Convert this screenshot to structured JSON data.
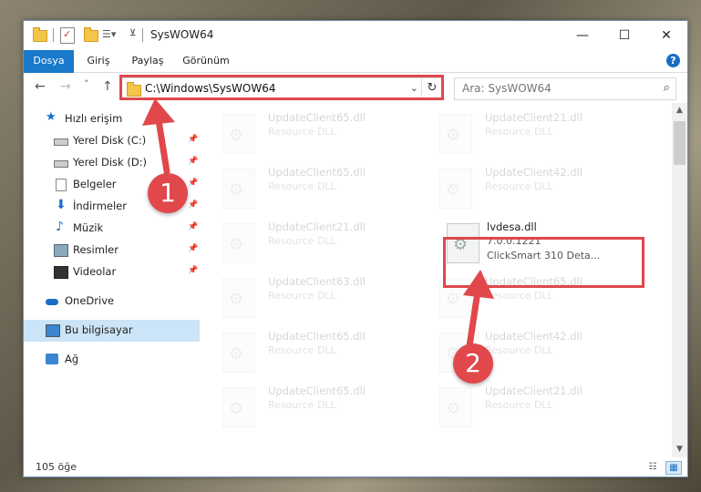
{
  "window": {
    "title": "SysWOW64"
  },
  "title_controls": {
    "minimize": "—",
    "maximize": "☐",
    "close": "✕"
  },
  "ribbon": {
    "tabs": [
      "Dosya",
      "Giriş",
      "Paylaş",
      "Görünüm"
    ],
    "help": "?"
  },
  "nav": {
    "back": "←",
    "forward": "→",
    "recent": "˅",
    "up": "↑",
    "address": "C:\\Windows\\SysWOW64",
    "address_chevron": "⌄",
    "refresh": "↻",
    "search_placeholder": "Ara: SysWOW64",
    "search_icon": "⌕"
  },
  "sidebar": {
    "items": [
      {
        "label": "Hızlı erişim",
        "icon": "star-icon",
        "pinned": false
      },
      {
        "label": "Yerel Disk (C:)",
        "icon": "drive-icon",
        "pinned": true
      },
      {
        "label": "Yerel Disk (D:)",
        "icon": "drive-icon",
        "pinned": true
      },
      {
        "label": "Belgeler",
        "icon": "documents-icon",
        "pinned": true
      },
      {
        "label": "İndirmeler",
        "icon": "downloads-icon",
        "pinned": true
      },
      {
        "label": "Müzik",
        "icon": "music-icon",
        "pinned": true
      },
      {
        "label": "Resimler",
        "icon": "pictures-icon",
        "pinned": true
      },
      {
        "label": "Videolar",
        "icon": "videos-icon",
        "pinned": true
      },
      {
        "label": "OneDrive",
        "icon": "cloud-icon",
        "pinned": false
      },
      {
        "label": "Bu bilgisayar",
        "icon": "computer-icon",
        "pinned": false,
        "selected": true
      },
      {
        "label": "Ağ",
        "icon": "network-icon",
        "pinned": false
      }
    ],
    "pin_glyph": "📌"
  },
  "files": {
    "left": [
      {
        "name": "UpdateClient65.dll",
        "desc": "Resource DLL"
      },
      {
        "name": "UpdateClient65.dll",
        "desc": "Resource DLL"
      },
      {
        "name": "UpdateClient21.dll",
        "desc": "Resource DLL"
      },
      {
        "name": "UpdateClient63.dll",
        "desc": "Resource DLL"
      },
      {
        "name": "UpdateClient65.dll",
        "desc": "Resource DLL"
      },
      {
        "name": "UpdateClient65.dll",
        "desc": "Resource DLL"
      }
    ],
    "right": [
      {
        "name": "UpdateClient21.dll",
        "desc": "Resource DLL"
      },
      {
        "name": "UpdateClient42.dll",
        "desc": "Resource DLL"
      },
      {
        "name": "UpdateClient65.dll",
        "desc": "Resource DLL"
      },
      {
        "name": "UpdateClient42.dll",
        "desc": "Resource DLL"
      },
      {
        "name": "UpdateClient21.dll",
        "desc": "Resource DLL"
      }
    ],
    "highlighted": {
      "name": "lvdesa.dll",
      "version": "7.0.0.1221",
      "desc": "ClickSmart 310 Deta..."
    }
  },
  "status": {
    "count": "105 öğe"
  },
  "annotations": {
    "step1": "1",
    "step2": "2"
  },
  "colors": {
    "accent": "#1979ca",
    "annotation": "#e0484c",
    "selected": "#cce4f7"
  }
}
